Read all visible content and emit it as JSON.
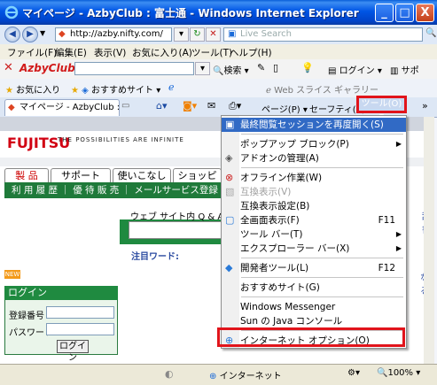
{
  "window": {
    "title": "マイページ - AzbyClub : 富士通 - Windows Internet Explorer",
    "controls": [
      "_",
      "□",
      "X"
    ]
  },
  "address": {
    "url": "http://azby.nifty.com/",
    "search_placeholder": "Live Search"
  },
  "menubar": [
    "ファイル(F)",
    "編集(E)",
    "表示(V)",
    "お気に入り(A)",
    "ツール(T)",
    "ヘルプ(H)"
  ],
  "azby_toolbar": {
    "logo": "AzbyClub",
    "search_label": "検索",
    "login_label": "ログイン",
    "support_label": "サポ"
  },
  "favorites_bar": {
    "favorites_label": "お気に入り",
    "suggested_sites": "おすすめサイト",
    "web_slice": "Web スライス ギャラリー"
  },
  "tabs": {
    "active_tab": "マイページ - AzbyClub : ...",
    "page_label": "ページ(P)",
    "safety_label": "セーフティ(S)",
    "tools_label": "ツール(O)"
  },
  "content": {
    "fujitsu_logo": "FUJITSU",
    "tagline": "THE POSSIBILITIES ARE INFINITE",
    "nav_tabs": [
      "製 品",
      "サポート",
      "使いこなし",
      "ショッピ"
    ],
    "green_bar": "利 用 履 歴 ｜ 優 待 販 売 ｜ メールサービス登録 ｜ メ",
    "web_search": "ウェブ  サイト内  Q & A",
    "notice": "注目ワード:",
    "new_badge": "NEW",
    "dict_link": "辞書",
    "naru_link": "なる",
    "login": {
      "heading": "ログイン",
      "member_number_label": "登録番号",
      "password_label": "パスワード",
      "login_button": "ログイン"
    }
  },
  "tools_menu": {
    "items": [
      {
        "label": "最終閲覧セッションを再度開く(S)",
        "shortcut": "",
        "submenu": false,
        "highlighted": true,
        "disabled": false,
        "icon": "reopen-session-icon"
      },
      {
        "sep": true
      },
      {
        "label": "ポップアップ ブロック(P)",
        "shortcut": "",
        "submenu": true,
        "highlighted": false,
        "disabled": false,
        "icon": ""
      },
      {
        "label": "アドオンの管理(A)",
        "shortcut": "",
        "submenu": false,
        "highlighted": false,
        "disabled": false,
        "icon": "addons-icon"
      },
      {
        "sep": true
      },
      {
        "label": "オフライン作業(W)",
        "shortcut": "",
        "submenu": false,
        "highlighted": false,
        "disabled": false,
        "icon": "offline-icon"
      },
      {
        "label": "互換表示(V)",
        "shortcut": "",
        "submenu": false,
        "highlighted": false,
        "disabled": true,
        "icon": "compat-icon"
      },
      {
        "label": "互換表示設定(B)",
        "shortcut": "",
        "submenu": false,
        "highlighted": false,
        "disabled": false,
        "icon": ""
      },
      {
        "label": "全画面表示(F)",
        "shortcut": "F11",
        "submenu": false,
        "highlighted": false,
        "disabled": false,
        "icon": "fullscreen-icon"
      },
      {
        "label": "ツール バー(T)",
        "shortcut": "",
        "submenu": true,
        "highlighted": false,
        "disabled": false,
        "icon": ""
      },
      {
        "label": "エクスプローラー バー(X)",
        "shortcut": "",
        "submenu": true,
        "highlighted": false,
        "disabled": false,
        "icon": ""
      },
      {
        "sep": true
      },
      {
        "label": "開発者ツール(L)",
        "shortcut": "F12",
        "submenu": false,
        "highlighted": false,
        "disabled": false,
        "icon": "developer-icon"
      },
      {
        "sep": true
      },
      {
        "label": "おすすめサイト(G)",
        "shortcut": "",
        "submenu": false,
        "highlighted": false,
        "disabled": false,
        "icon": ""
      },
      {
        "sep": true
      },
      {
        "label": "Windows Messenger",
        "shortcut": "",
        "submenu": false,
        "highlighted": false,
        "disabled": false,
        "icon": ""
      },
      {
        "label": "Sun の Java コンソール",
        "shortcut": "",
        "submenu": false,
        "highlighted": false,
        "disabled": false,
        "icon": ""
      },
      {
        "sep": true
      },
      {
        "label": "インターネット オプション(O)",
        "shortcut": "",
        "submenu": false,
        "highlighted": false,
        "disabled": false,
        "icon": "internet-options-icon"
      }
    ]
  },
  "statusbar": {
    "zone": "インターネット",
    "zoom": "100%"
  },
  "colors": {
    "highlight": "#316ac5",
    "annotation_red": "#e1141b",
    "fujitsu_red": "#d10012",
    "green": "#1f7a3a"
  }
}
